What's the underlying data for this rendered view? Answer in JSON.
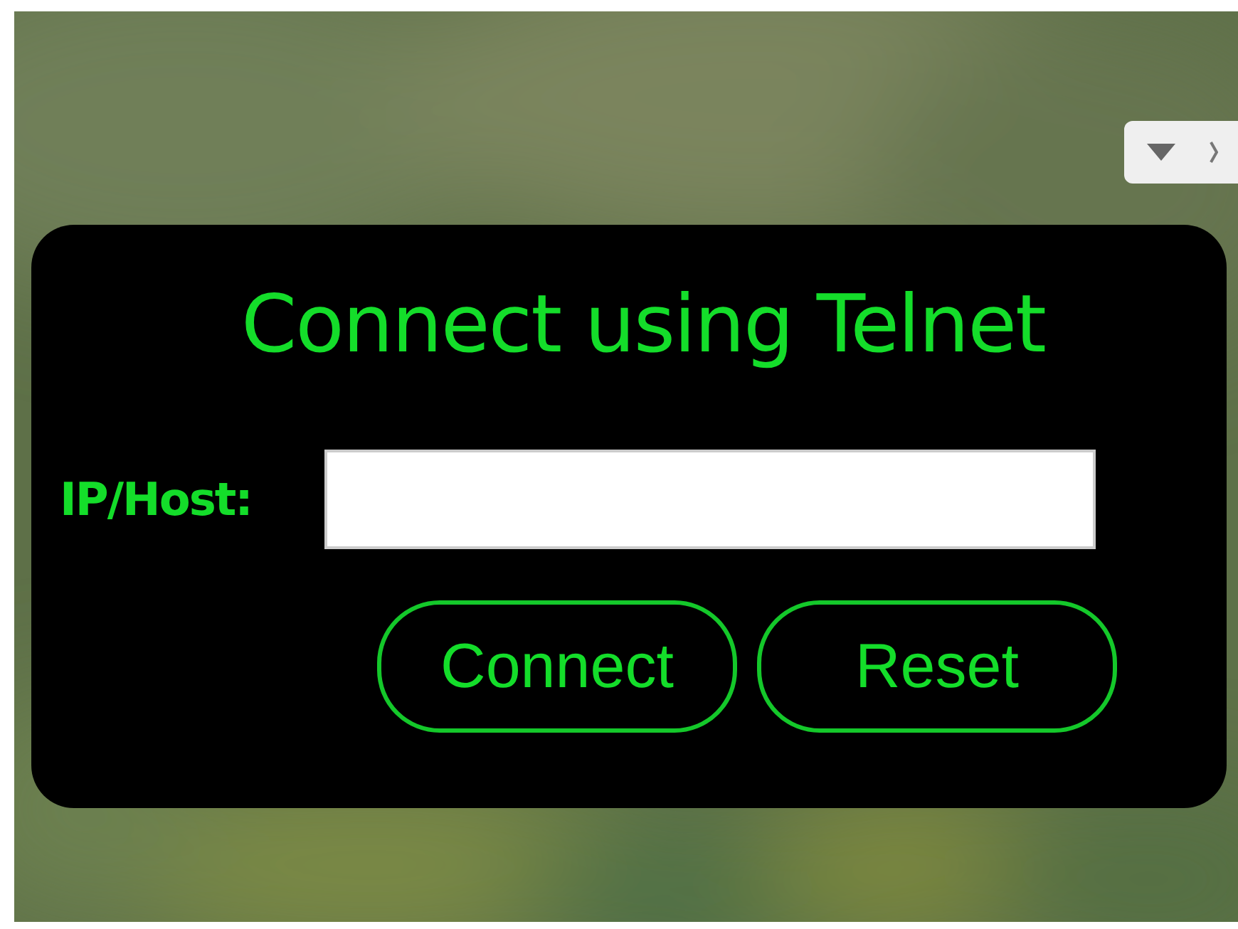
{
  "dialog": {
    "title": "Connect using Telnet",
    "field": {
      "label": "IP/Host:"
    },
    "buttons": [
      {
        "label": "Connect"
      },
      {
        "label": "Reset"
      }
    ]
  }
}
